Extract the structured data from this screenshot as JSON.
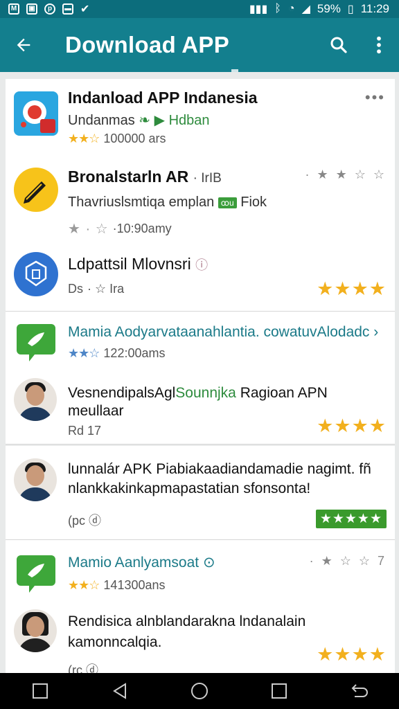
{
  "status_bar": {
    "battery": "59%",
    "time": "11:29",
    "left_icons": [
      "mail-icon",
      "photo-icon",
      "pinterest-icon",
      "image-icon",
      "check-icon"
    ]
  },
  "app_bar": {
    "title": "Download APP",
    "icons": [
      "back-arrow-icon",
      "search-icon",
      "more-vert-icon"
    ]
  },
  "items": [
    {
      "name": "Indanload APP Indanesia",
      "developer": "Undanmas",
      "tag": "Hdban",
      "stars": "★★☆",
      "downloads": "100000 ars",
      "overflow": "•••"
    },
    {
      "name": "Bronalstarln AR",
      "name_suffix": "· IrIB",
      "sub": "Thavriuslsmtiqa empl​an",
      "chip": "ꝏu",
      "sub_suffix": "Fiok",
      "stars": "★ · ☆",
      "downloads": "·10:90amy",
      "top_rating": "· ★ ★ ☆ ☆"
    },
    {
      "name": "Ldpattsil Mlovnsri",
      "meta_left": "Ds",
      "meta_right": "· ☆ Ira",
      "rating": "★★★★"
    },
    {
      "name": "Mamia Aodyarvataanahlantia. cowatuvAlodadc",
      "chevron": "›",
      "stars": "★★☆",
      "downloads": "122:00ams"
    },
    {
      "name_part1": "VesnendipalsAgl",
      "name_part2": "Sounnjka",
      "name_part3": " Ragioan APN",
      "name_line2": "meullaar",
      "meta": "Rd 17",
      "rating": "★★★★"
    },
    {
      "name_line1": "lunnalár APK Piabiakaadiandamadie nagimt. fñ",
      "name_line2": "nlankkakinkapmapastatian sfonsonta!",
      "meta": "(pc ⓓ",
      "badge": "★★★★★"
    },
    {
      "name": "Mamio Aanlyamsoat",
      "stars": "★★☆",
      "downloads": "141300ans",
      "top_rating": "· ★ ☆ ☆ 7"
    },
    {
      "name_line1": "Rendisica alnblandarakna lndanalain",
      "name_line2": "kamonncalqia.",
      "meta": "(rc ⓓ",
      "rating": "★★★★"
    }
  ],
  "colors": {
    "status_bar": "#0c6d7c",
    "app_bar": "#137f8e",
    "star": "#f2b01e",
    "green_badge": "#3a9a2c",
    "teal_text": "#1b7a88"
  },
  "nav_bar": {
    "icons": [
      "recent-square-icon",
      "back-triangle-icon",
      "home-circle-icon",
      "overview-square-icon",
      "return-icon"
    ]
  }
}
